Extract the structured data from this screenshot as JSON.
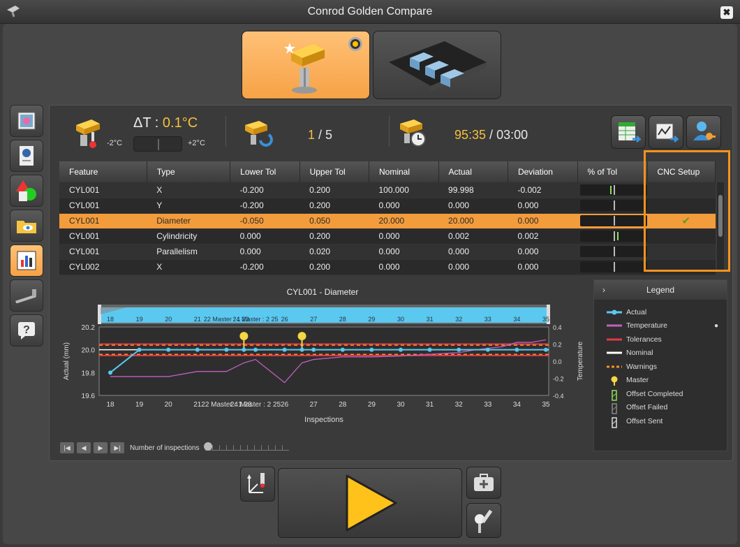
{
  "window": {
    "title": "Conrod Golden Compare",
    "close_label": "✖"
  },
  "stats": {
    "delta_prefix": "ΔT : ",
    "delta_value": "0.1°C",
    "delta_min": "-2°C",
    "delta_max": "+2°C",
    "count_current": "1",
    "count_sep": " / ",
    "count_total": "5",
    "time_elapsed": "95:35",
    "time_sep": " / ",
    "time_total": "03:00"
  },
  "table": {
    "columns": [
      "Feature",
      "Type",
      "Lower Tol",
      "Upper Tol",
      "Nominal",
      "Actual",
      "Deviation",
      "% of Tol",
      "CNC Setup"
    ],
    "rows": [
      {
        "feature": "CYL001",
        "type": "X",
        "lower": "-0.200",
        "upper": "0.200",
        "nominal": "100.000",
        "actual": "99.998",
        "deviation": "-0.002",
        "pct": -0.01,
        "cnc": ""
      },
      {
        "feature": "CYL001",
        "type": "Y",
        "lower": "-0.200",
        "upper": "0.200",
        "nominal": "0.000",
        "actual": "0.000",
        "deviation": "0.000",
        "pct": 0,
        "cnc": ""
      },
      {
        "feature": "CYL001",
        "type": "Diameter",
        "lower": "-0.050",
        "upper": "0.050",
        "nominal": "20.000",
        "actual": "20.000",
        "deviation": "0.000",
        "pct": 0,
        "cnc": "✔"
      },
      {
        "feature": "CYL001",
        "type": "Cylindricity",
        "lower": "0.000",
        "upper": "0.200",
        "nominal": "0.000",
        "actual": "0.002",
        "deviation": "0.002",
        "pct": 0.01,
        "cnc": ""
      },
      {
        "feature": "CYL001",
        "type": "Parallelism",
        "lower": "0.000",
        "upper": "0.020",
        "nominal": "0.000",
        "actual": "0.000",
        "deviation": "0.000",
        "pct": 0,
        "cnc": ""
      },
      {
        "feature": "CYL002",
        "type": "X",
        "lower": "-0.200",
        "upper": "0.200",
        "nominal": "0.000",
        "actual": "0.000",
        "deviation": "0.000",
        "pct": 0,
        "cnc": ""
      }
    ],
    "selected_index": 2
  },
  "chart_data": {
    "type": "line",
    "title": "CYL001 - Diameter",
    "xlabel": "Inspections",
    "ylabel": "Actual (mm)",
    "y2label": "Temperature",
    "x_ticks": [
      "18",
      "19",
      "20",
      "21",
      "22 Master : 1 23",
      "24 Master : 2 25",
      "26",
      "27",
      "28",
      "29",
      "30",
      "31",
      "32",
      "33",
      "34",
      "35"
    ],
    "ylim": [
      19.6,
      20.2
    ],
    "y_ticks": [
      "20.2",
      "20.0",
      "19.8",
      "19.6"
    ],
    "y2lim": [
      -0.4,
      0.4
    ],
    "y2_ticks": [
      "0.4",
      "0.2",
      "0.0",
      "-0.2",
      "-0.4"
    ],
    "series": [
      {
        "name": "Actual",
        "color": "#5bc8f0",
        "values": [
          19.8,
          20.0,
          20.0,
          20.0,
          20.0,
          20.0,
          20.0,
          20.0,
          20.0,
          20.0,
          20.0,
          20.0,
          20.0,
          20.0,
          20.0,
          20.0,
          20.0,
          20.0
        ]
      },
      {
        "name": "Temperature",
        "color": "#c060c0",
        "y2": true,
        "values": [
          -0.18,
          -0.18,
          -0.18,
          -0.12,
          -0.12,
          -0.02,
          0.02,
          -0.25,
          -0.02,
          0.02,
          0.05,
          0.05,
          0.06,
          0.08,
          0.1,
          0.13,
          0.15,
          0.17,
          0.22,
          0.22,
          0.25
        ]
      }
    ],
    "x_index": [
      0,
      1,
      2,
      3,
      4,
      4.6,
      5,
      6,
      6.6,
      7,
      8,
      9,
      10,
      11,
      12,
      13,
      14,
      15
    ],
    "temperature_x": [
      0,
      1,
      2,
      3,
      4,
      4.6,
      5,
      6,
      6.6,
      7,
      8,
      9,
      10,
      11,
      12,
      12.5,
      13,
      13.5,
      14,
      14.5,
      15
    ],
    "masters": [
      4.6,
      6.6
    ],
    "tolerances": [
      19.95,
      20.05
    ],
    "warnings": [
      19.96,
      20.04
    ],
    "nominal": 20.0,
    "scroll_labels": [
      "18",
      "19",
      "20",
      "21",
      "22 Master : 1 23",
      "24 Master : 2 25",
      "26",
      "27",
      "28",
      "29",
      "30",
      "31",
      "32",
      "33",
      "34",
      "35"
    ]
  },
  "legend": {
    "title": "Legend",
    "items": [
      {
        "label": "Actual",
        "color": "#5bc8f0"
      },
      {
        "label": "Temperature",
        "color": "#c060c0"
      },
      {
        "label": "Tolerances",
        "color": "#e8364a"
      },
      {
        "label": "Nominal",
        "color": "#ffffff"
      },
      {
        "label": "Warnings",
        "color": "#f7931e"
      },
      {
        "label": "Master",
        "color": "#f5d743"
      },
      {
        "label": "Offset Completed",
        "color": "#8fe05a"
      },
      {
        "label": "Offset Failed",
        "color": "#888888"
      },
      {
        "label": "Offset Sent",
        "color": "#dddddd"
      }
    ]
  },
  "nav": {
    "label": "Number of inspections"
  }
}
